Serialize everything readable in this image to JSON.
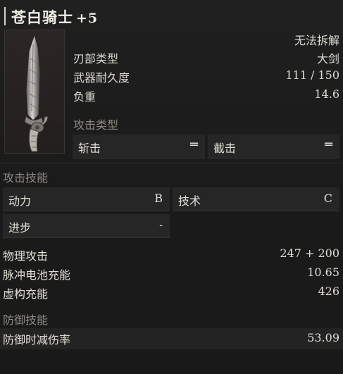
{
  "item": {
    "name": "苍白骑士",
    "upgrade": "+5",
    "weapon_image": "pale-knight-sword-icon",
    "dismantle_status": "无法拆解"
  },
  "info": [
    {
      "label": "刃部类型",
      "value": "大剑"
    },
    {
      "label": "武器耐久度",
      "value": "111 / 150"
    },
    {
      "label": "负重",
      "value": "14.6"
    }
  ],
  "attack_type": {
    "section_label": "攻击类型",
    "items": [
      {
        "label": "斩击",
        "value": "═"
      },
      {
        "label": "截击",
        "value": "═"
      }
    ]
  },
  "attack_skill": {
    "section_label": "攻击技能",
    "items": [
      {
        "label": "动力",
        "value": "B"
      },
      {
        "label": "技术",
        "value": "C"
      },
      {
        "label": "进步",
        "value": "-"
      }
    ]
  },
  "attributes": [
    {
      "label": "物理攻击",
      "value": "247 + 200"
    },
    {
      "label": "脉冲电池充能",
      "value": "10.65"
    },
    {
      "label": "虚构充能",
      "value": "426"
    }
  ],
  "defense_skill": {
    "section_label": "防御技能",
    "items": [
      {
        "label": "防御时减伤率",
        "value": "53.09"
      }
    ]
  },
  "colors": {
    "background": "#1a1a1a",
    "text": "#e6e2dc",
    "muted": "#8d8883",
    "box": "#262626"
  }
}
